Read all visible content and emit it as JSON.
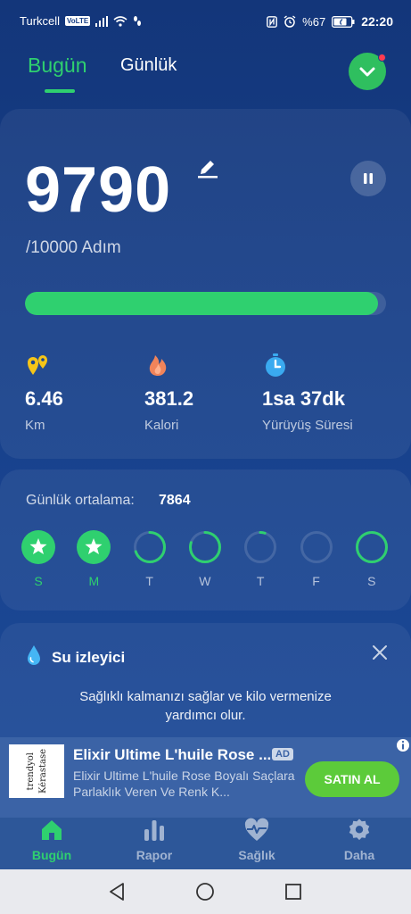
{
  "status_bar": {
    "carrier": "Turkcell",
    "volte": "VoLTE",
    "battery": "%67",
    "time": "22:20"
  },
  "header": {
    "tabs": [
      {
        "label": "Bugün",
        "active": true
      },
      {
        "label": "Günlük",
        "active": false
      }
    ],
    "action_icon": "chevron-down-icon",
    "notification_dot": true
  },
  "steps": {
    "value": "9790",
    "goal_text": "/10000 Adım",
    "progress_fraction": 0.979,
    "edit_icon": "pencil-icon",
    "pause_icon": "pause-icon"
  },
  "stats": [
    {
      "icon": "location-pins-icon",
      "value": "6.46",
      "label": "Km",
      "color": "#f5c518"
    },
    {
      "icon": "flame-icon",
      "value": "381.2",
      "label": "Kalori",
      "color": "#f0845a"
    },
    {
      "icon": "stopwatch-icon",
      "value": "1sa 37dk",
      "label": "Yürüyüş Süresi",
      "color": "#3aaaf0"
    }
  ],
  "weekly": {
    "avg_label": "Günlük ortalama:",
    "avg_value": "7864",
    "days": [
      {
        "letter": "S",
        "done": true,
        "progress": 1.0
      },
      {
        "letter": "M",
        "done": true,
        "progress": 1.0
      },
      {
        "letter": "T",
        "done": false,
        "progress": 0.7
      },
      {
        "letter": "W",
        "done": false,
        "progress": 0.8
      },
      {
        "letter": "T",
        "done": false,
        "progress": 0.05
      },
      {
        "letter": "F",
        "done": false,
        "progress": 0.0
      },
      {
        "letter": "S",
        "done": false,
        "progress": 0.979
      }
    ]
  },
  "water": {
    "title": "Su izleyici",
    "description": "Sağlıklı kalmanızı sağlar ve kilo vermenize yardımcı olur."
  },
  "ad": {
    "title": "Elixir Ultime L'huile Rose ...",
    "badge": "AD",
    "body": "Elixir Ultime L'huile Rose Boyalı Saçlara Parlaklık Veren Ve Renk K...",
    "cta": "SATIN AL",
    "thumb_text_1": "trendyol",
    "thumb_text_2": "Kérastase"
  },
  "bottom_nav": [
    {
      "icon": "home-icon",
      "label": "Bugün",
      "active": true
    },
    {
      "icon": "bar-chart-icon",
      "label": "Rapor",
      "active": false
    },
    {
      "icon": "heart-pulse-icon",
      "label": "Sağlık",
      "active": false
    },
    {
      "icon": "gear-icon",
      "label": "Daha",
      "active": false
    }
  ],
  "colors": {
    "accent": "#2fd06f",
    "background": "#18418c"
  }
}
